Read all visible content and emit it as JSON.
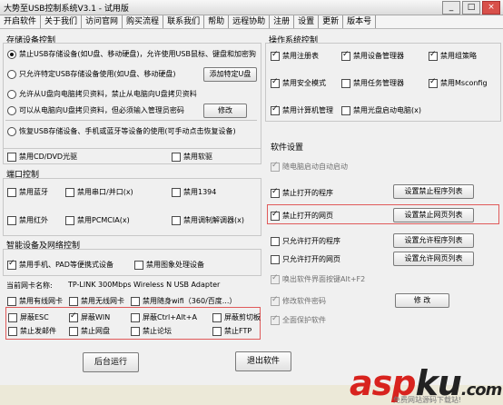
{
  "window": {
    "title": "大势至USB控制系统V3.1 - 试用版",
    "controls": [
      "_",
      "□",
      "×"
    ]
  },
  "menu": [
    "开启软件",
    "关于我们",
    "访问官网",
    "购买流程",
    "联系我们",
    "帮助",
    "远程协助",
    "注册",
    "设置",
    "更新",
    "版本号"
  ],
  "storage": {
    "title": "存储设备控制",
    "opt1": "禁止USB存储设备(如U盘、移动硬盘)，允许使用USB鼠标、键盘和加密狗",
    "opt2": "只允许特定USB存储设备使用(如U盘、移动硬盘)",
    "opt2_btn": "添加特定U盘",
    "opt3": "允许从U盘向电脑拷贝资料，禁止从电脑向U盘拷贝资料",
    "opt4": "可以从电脑向U盘拷贝资料，但必须输入管理员密码",
    "opt4_btn": "修改",
    "opt5": "恢复USB存储设备、手机或蓝牙等设备的使用(可手动点击恢复设备)",
    "cd": "禁用CD/DVD光驱",
    "floppy": "禁用软驱"
  },
  "ports": {
    "title": "端口控制",
    "bluetooth": "禁用蓝牙",
    "serial": "禁用串口/并口(x)",
    "p1394": "禁用1394",
    "infrared": "禁用红外",
    "pcmcia": "禁用PCMCIA(x)",
    "modem": "禁用调制解调器(x)"
  },
  "smart": {
    "title": "智能设备及网络控制",
    "phone": "禁用手机、PAD等便携式设备",
    "imaging": "禁用图象处理设备",
    "adapter_label": "当前网卡名称:",
    "adapter_value": "TP-LINK 300Mbps Wireless N USB Adapter",
    "wired": "禁用有线网卡",
    "wireless": "禁用无线网卡",
    "wifi": "禁用随身wifi（360/百度...）"
  },
  "block": {
    "esc": "屏蔽ESC",
    "win": "屏蔽WIN",
    "ctrlalta": "屏蔽Ctrl+Alt+A",
    "clipboard": "屏蔽剪切板",
    "email": "禁止发邮件",
    "netdisk": "禁止网盘",
    "forum": "禁止论坛",
    "ftp": "禁止FTP"
  },
  "os": {
    "title": "操作系统控制",
    "registry": "禁用注册表",
    "devmgr": "禁用设备管理器",
    "gpedit": "禁用组策略",
    "safemode": "禁用安全模式",
    "taskmgr": "禁用任务管理器",
    "msconfig": "禁用Msconfig",
    "compmgmt": "禁用计算机管理",
    "cdboot": "禁用光盘启动电脑(x)"
  },
  "software": {
    "title": "软件设置",
    "autostart": "随电脑启动自动启动",
    "block_prog": "禁止打开的程序",
    "block_prog_btn": "设置禁止程序列表",
    "block_web": "禁止打开的网页",
    "block_web_btn": "设置禁止网页列表",
    "allow_prog": "只允许打开的程序",
    "allow_prog_btn": "设置允许程序列表",
    "allow_web": "只允许打开的网页",
    "allow_web_btn": "设置允许网页列表",
    "hotkey": "唤出软件界面按键Alt+F2",
    "password": "修改软件密码",
    "password_btn": "修 改",
    "fullprotect": "全面保护软件"
  },
  "bottom": {
    "run_bg": "后台运行",
    "exit": "退出软件"
  },
  "watermark": {
    "logo_a": "asp",
    "logo_b": "ku",
    "logo_c": ".com",
    "sub": "免费网站源码下载站!"
  }
}
